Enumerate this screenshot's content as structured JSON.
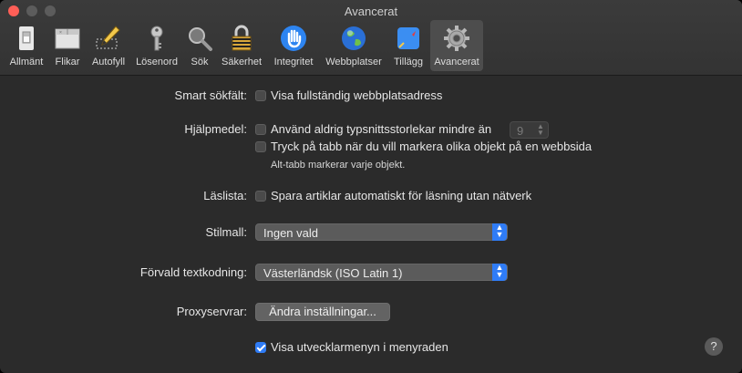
{
  "window": {
    "title": "Avancerat"
  },
  "toolbar": {
    "tabs": [
      {
        "label": "Allmänt",
        "icon": "switch-icon"
      },
      {
        "label": "Flikar",
        "icon": "tabs-icon"
      },
      {
        "label": "Autofyll",
        "icon": "pencil-icon"
      },
      {
        "label": "Lösenord",
        "icon": "key-icon"
      },
      {
        "label": "Sök",
        "icon": "magnifier-icon"
      },
      {
        "label": "Säkerhet",
        "icon": "padlock-icon"
      },
      {
        "label": "Integritet",
        "icon": "hand-icon"
      },
      {
        "label": "Webbplatser",
        "icon": "globe-icon"
      },
      {
        "label": "Tillägg",
        "icon": "extensions-icon"
      },
      {
        "label": "Avancerat",
        "icon": "gear-icon",
        "selected": true
      }
    ]
  },
  "settings": {
    "smart_search": {
      "label": "Smart sökfält:",
      "option": "Visa fullständig webbplatsadress",
      "checked": false
    },
    "accessibility": {
      "label": "Hjälpmedel:",
      "min_font_option": "Använd aldrig typsnittsstorlekar mindre än",
      "min_font_checked": false,
      "min_font_value": "9",
      "tab_option": "Tryck på tabb när du vill markera olika objekt på en webbsida",
      "tab_checked": false,
      "tab_hint": "Alt-tabb markerar varje objekt."
    },
    "reading_list": {
      "label": "Läslista:",
      "option": "Spara artiklar automatiskt för läsning utan nätverk",
      "checked": false
    },
    "style_sheet": {
      "label": "Stilmall:",
      "value": "Ingen vald"
    },
    "encoding": {
      "label": "Förvald textkodning:",
      "value": "Västerländsk (ISO Latin 1)"
    },
    "proxies": {
      "label": "Proxyservrar:",
      "button": "Ändra inställningar..."
    },
    "develop_menu": {
      "option": "Visa utvecklarmenyn i menyraden",
      "checked": true
    }
  },
  "help": {
    "label": "?"
  },
  "colors": {
    "accent": "#2f7cf6",
    "window_bg": "#2b2b2b",
    "close_button": "#ff5f57"
  }
}
